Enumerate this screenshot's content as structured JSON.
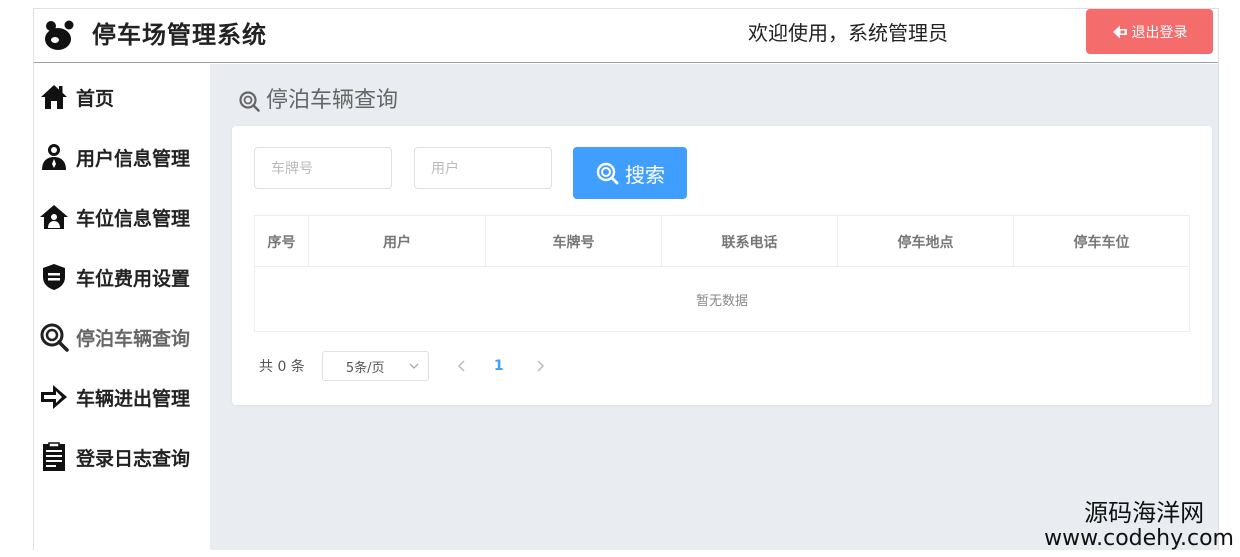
{
  "header": {
    "app_title": "停车场管理系统",
    "welcome": "欢迎使用，系统管理员",
    "logout_label": "退出登录",
    "logout_color": "#f56c6c"
  },
  "sidebar": {
    "items": [
      {
        "label": "首页",
        "icon": "home-icon"
      },
      {
        "label": "用户信息管理",
        "icon": "user-icon"
      },
      {
        "label": "车位信息管理",
        "icon": "house-icon"
      },
      {
        "label": "车位费用设置",
        "icon": "shield-icon"
      },
      {
        "label": "停泊车辆查询",
        "icon": "search-icon",
        "active": true
      },
      {
        "label": "车辆进出管理",
        "icon": "arrow-right-icon"
      },
      {
        "label": "登录日志查询",
        "icon": "document-icon"
      }
    ]
  },
  "main": {
    "page_title": "停泊车辆查询",
    "search": {
      "plate_placeholder": "车牌号",
      "user_placeholder": "用户",
      "button_label": "搜索",
      "button_color": "#409eff"
    },
    "table": {
      "columns": [
        "序号",
        "用户",
        "车牌号",
        "联系电话",
        "停车地点",
        "停车车位"
      ],
      "empty_text": "暂无数据"
    },
    "pagination": {
      "total": "共 0 条",
      "page_size": "5条/页",
      "current_page": "1"
    }
  },
  "watermark": {
    "line1": "源码海洋网",
    "line2": "www.codehy.com"
  }
}
